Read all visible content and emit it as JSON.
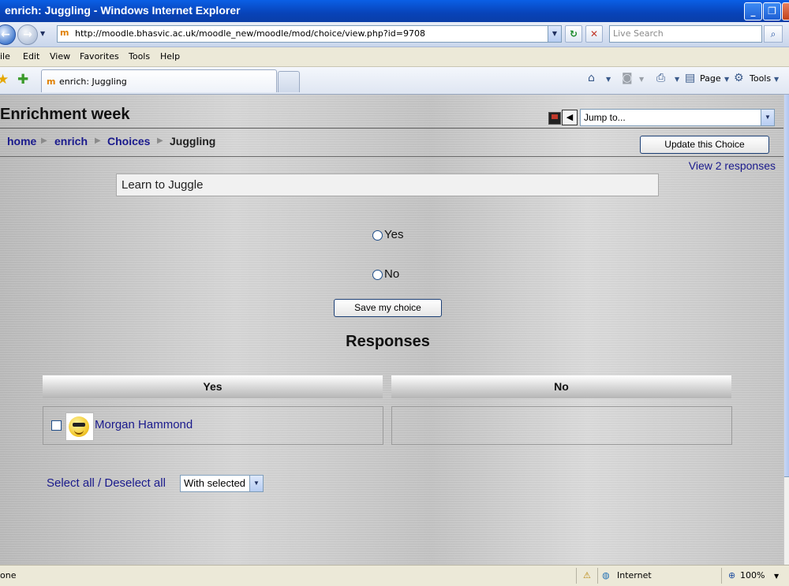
{
  "window": {
    "title": "enrich: Juggling - Windows Internet Explorer"
  },
  "address": {
    "url": "http://moodle.bhasvic.ac.uk/moodle_new/moodle/mod/choice/view.php?id=9708",
    "search_placeholder": "Live Search"
  },
  "menu": {
    "items": [
      "ile",
      "Edit",
      "View",
      "Favorites",
      "Tools",
      "Help"
    ]
  },
  "tabs": {
    "active_label": "enrich: Juggling",
    "page_label": "Page",
    "tools_label": "Tools"
  },
  "page": {
    "course_header": "Enrichment week",
    "jump_to": "Jump to...",
    "breadcrumb": [
      "home",
      "enrich",
      "Choices",
      "Juggling"
    ],
    "update_button": "Update this Choice",
    "view_responses": "View 2 responses",
    "question": "Learn to Juggle",
    "options": [
      "Yes",
      "No"
    ],
    "save_button": "Save my choice",
    "responses_heading": "Responses",
    "columns": [
      "Yes",
      "No"
    ],
    "yes_responses": [
      {
        "name": "Morgan Hammond"
      }
    ],
    "select_all": "Select all / Deselect all",
    "with_selected": "With selected"
  },
  "status": {
    "left_text": "one",
    "zone": "Internet",
    "zoom": "100%"
  }
}
